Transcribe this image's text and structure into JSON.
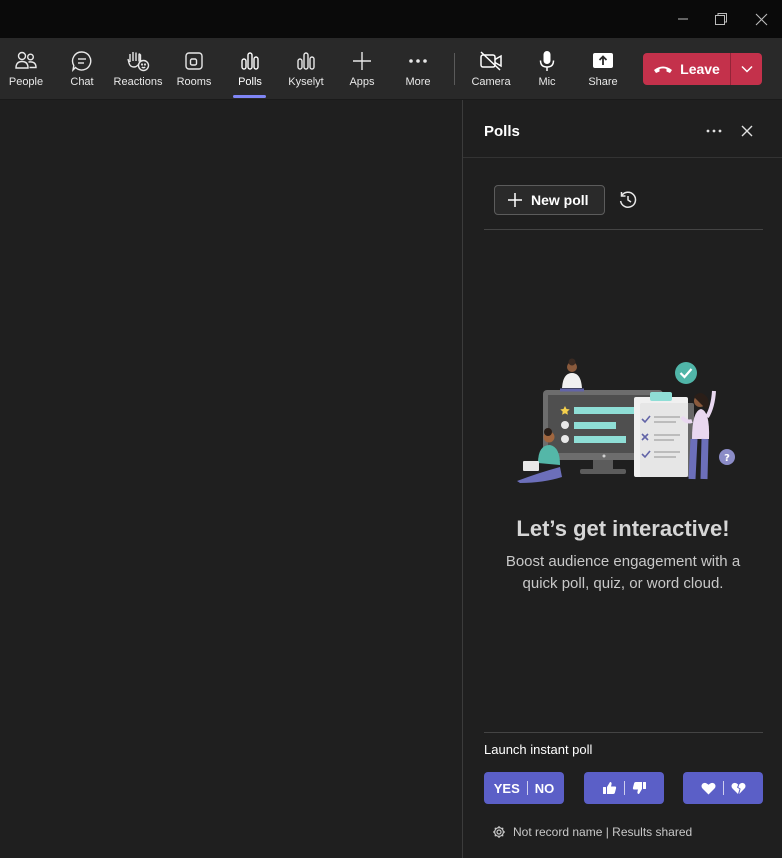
{
  "titlebar": {
    "icons": [
      "minimize-icon",
      "restore-icon",
      "close-icon"
    ]
  },
  "toolbar": {
    "items": [
      {
        "label": "People",
        "icon": "people-icon"
      },
      {
        "label": "Chat",
        "icon": "chat-icon"
      },
      {
        "label": "Reactions",
        "icon": "raise-hand-icon"
      },
      {
        "label": "Rooms",
        "icon": "rooms-icon"
      },
      {
        "label": "Polls",
        "icon": "polls-icon",
        "active": true
      },
      {
        "label": "Kyselyt",
        "icon": "polls-icon"
      },
      {
        "label": "Apps",
        "icon": "plus-icon"
      },
      {
        "label": "More",
        "icon": "more-icon"
      },
      {
        "label": "Camera",
        "icon": "camera-off-icon"
      },
      {
        "label": "Mic",
        "icon": "mic-icon"
      },
      {
        "label": "Share",
        "icon": "share-icon"
      }
    ],
    "leave_label": "Leave"
  },
  "panel": {
    "title": "Polls",
    "new_poll_label": "New poll",
    "empty_title": "Let’s get interactive!",
    "empty_desc": "Boost audience engagement with a quick poll, quiz, or word cloud.",
    "launch_label": "Launch instant poll",
    "quick_polls": [
      {
        "left": "YES",
        "right": "NO"
      },
      {
        "left_icon": "thumbs-up-icon",
        "right_icon": "thumbs-down-icon"
      },
      {
        "left_icon": "heart-icon",
        "right_icon": "broken-heart-icon"
      }
    ],
    "footer_note": "Not record name | Results shared"
  },
  "colors": {
    "accent": "#5b5fc7",
    "leave": "#c4314b",
    "active_indicator": "#7f85f5",
    "background": "#1f1f1f"
  }
}
